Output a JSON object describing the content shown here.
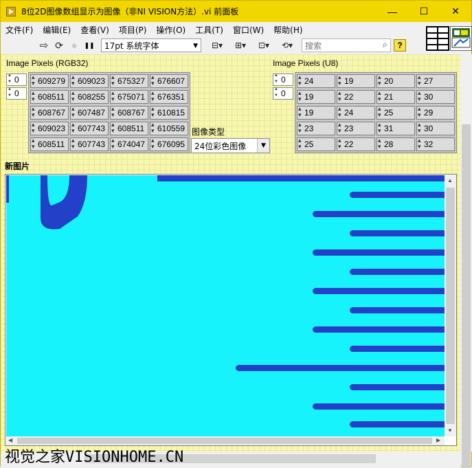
{
  "window": {
    "title": "8位2D图像数组显示为图像（非NI VISION方法）.vi 前面板",
    "minimize": "—",
    "maximize": "☐",
    "close": "✕"
  },
  "menu": [
    "文件(F)",
    "编辑(E)",
    "查看(V)",
    "项目(P)",
    "操作(O)",
    "工具(T)",
    "窗口(W)",
    "帮助(H)"
  ],
  "toolbar": {
    "run_glyph": "⇨",
    "run_cont_glyph": "⟳",
    "abort_glyph": "●",
    "pause_glyph": "❚❚",
    "font": "17pt 系统字体",
    "align_glyph": "⊟▾",
    "distribute_glyph": "⊞▾",
    "resize_glyph": "⊡▾",
    "reorder_glyph": "⟲▾",
    "search_placeholder": "搜索",
    "help": "?"
  },
  "rgb_array": {
    "label": "Image Pixels (RGB32)",
    "index_row": "0",
    "index_col": "0",
    "rows": [
      [
        "609279",
        "609023",
        "675327",
        "676607"
      ],
      [
        "608511",
        "608255",
        "675071",
        "676351"
      ],
      [
        "608767",
        "607487",
        "608767",
        "610815"
      ],
      [
        "609023",
        "607743",
        "608511",
        "610559"
      ],
      [
        "608511",
        "607743",
        "674047",
        "676095"
      ]
    ]
  },
  "u8_array": {
    "label": "Image Pixels (U8)",
    "index_row": "0",
    "index_col": "0",
    "rows": [
      [
        "24",
        "19",
        "20",
        "27"
      ],
      [
        "19",
        "22",
        "21",
        "30"
      ],
      [
        "19",
        "24",
        "25",
        "29"
      ],
      [
        "23",
        "23",
        "31",
        "30"
      ],
      [
        "25",
        "22",
        "28",
        "32"
      ]
    ]
  },
  "image_type": {
    "label": "图像类型",
    "value": "24位彩色图像"
  },
  "image": {
    "label": "新图片",
    "fill_color": "#17f3fd",
    "mark_color": "#2340c8"
  },
  "watermark": "视觉之家VISIONHOME.CN"
}
